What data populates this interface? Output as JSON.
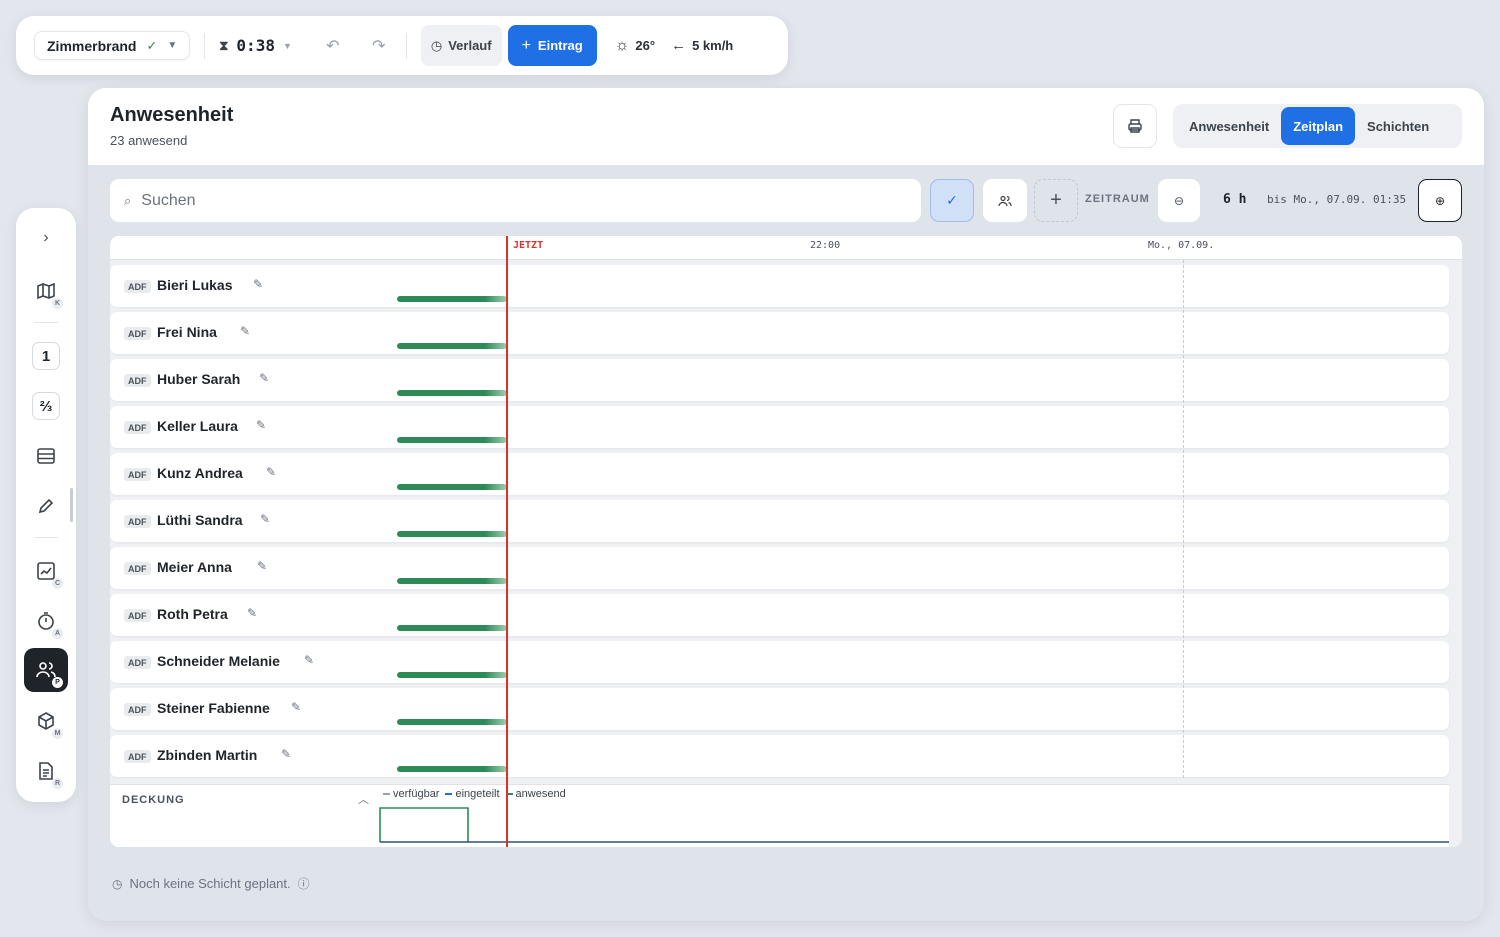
{
  "topbar": {
    "incident_name": "Zimmerbrand",
    "timer": "0:38",
    "verlauf_label": "Verlauf",
    "eintrag_label": "Eintrag",
    "temperature": "26°",
    "wind": "5 km/h"
  },
  "rail": {
    "map_sub": "K",
    "badge_1": "1",
    "badge_fraction": "⅔",
    "chart_sub": "C",
    "timer_sub": "A",
    "people_sub": "P",
    "cube_sub": "M",
    "doc_sub": "R"
  },
  "header": {
    "title": "Anwesenheit",
    "subtitle": "23 anwesend",
    "tabs": [
      {
        "label": "Anwesenheit",
        "active": false
      },
      {
        "label": "Zeitplan",
        "active": true
      },
      {
        "label": "Schichten",
        "active": false
      }
    ]
  },
  "filter": {
    "search_placeholder": "Suchen",
    "zeitraum_label": "ZEITRAUM",
    "hours": "6 h",
    "until": "bis Mo., 07.09. 01:35"
  },
  "timeline": {
    "now_label": "JETZT",
    "tick_1": "22:00",
    "tick_2": "Mo., 07.09."
  },
  "rows": [
    {
      "tag": "ADF",
      "name": "Bieri Lukas"
    },
    {
      "tag": "ADF",
      "name": "Frei Nina"
    },
    {
      "tag": "ADF",
      "name": "Huber Sarah"
    },
    {
      "tag": "ADF",
      "name": "Keller Laura"
    },
    {
      "tag": "ADF",
      "name": "Kunz Andrea"
    },
    {
      "tag": "ADF",
      "name": "Lüthi Sandra"
    },
    {
      "tag": "ADF",
      "name": "Meier Anna"
    },
    {
      "tag": "ADF",
      "name": "Roth Petra"
    },
    {
      "tag": "ADF",
      "name": "Schneider Melanie"
    },
    {
      "tag": "ADF",
      "name": "Steiner Fabienne"
    },
    {
      "tag": "ADF",
      "name": "Zbinden Martin"
    }
  ],
  "deckung": {
    "title": "DECKUNG",
    "legend": [
      "verfügbar",
      "eingeteilt",
      "anwesend"
    ],
    "colors": {
      "verfuegbar": "#9aa1ab",
      "eingeteilt": "#1f6fe5",
      "anwesend": "#2e8b57"
    }
  },
  "footer": {
    "note": "Noch keine Schicht geplant."
  },
  "colors": {
    "accent": "#1f6fe5",
    "now_line": "#d9342b",
    "present": "#2e8b57"
  }
}
